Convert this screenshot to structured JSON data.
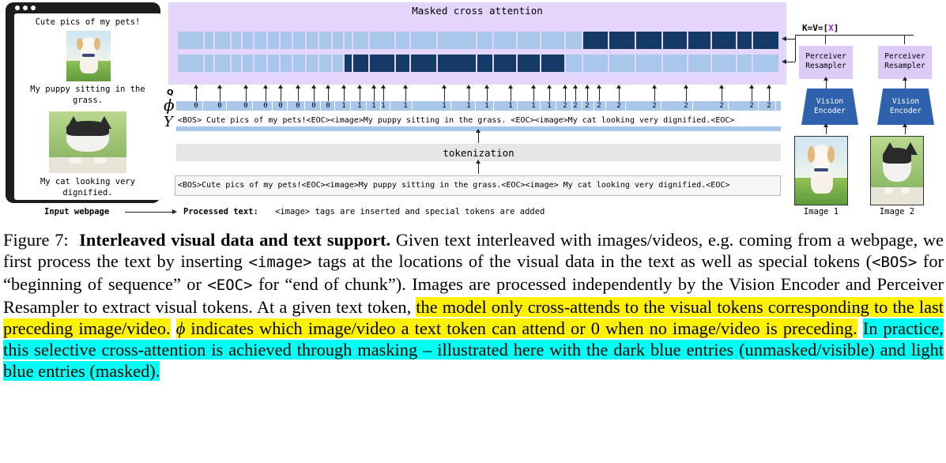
{
  "webpage": {
    "heading": "Cute pics of my pets!",
    "caption_1": "My puppy sitting in the grass.",
    "caption_2": "My cat looking very dignified.",
    "label": "Input webpage"
  },
  "attention": {
    "title": "Masked cross attention",
    "row_1_mask": "light for tokens before second <image>, dark (visible) after it",
    "q_label": "Q"
  },
  "sequence": {
    "phi_symbol": "ϕ",
    "y_symbol": "Y",
    "phi_values": [
      "0",
      "0",
      "0",
      "0",
      "0",
      "0",
      "0",
      "0",
      "1",
      "1",
      "1",
      "1",
      "1",
      "1",
      "1",
      "1",
      "1",
      "1",
      "1",
      "2",
      "2",
      "2",
      "2",
      "2",
      "2",
      "2",
      "2",
      "2",
      "2",
      "2"
    ],
    "y_text": "<BOS> Cute pics of my pets!<EOC><image>My puppy sitting in the grass. <EOC><image>My cat looking very dignified.<EOC>"
  },
  "tokenization": {
    "label": "tokenization",
    "raw_text": "<BOS>Cute pics of my pets!<EOC><image>My puppy sitting in the grass.<EOC><image> My cat looking very dignified.<EOC>"
  },
  "processed": {
    "label": "Processed text:",
    "description": "<image> tags are inserted and special tokens are added"
  },
  "encoders": {
    "kv_label": "K=V=[",
    "kv_x": "X",
    "kv_close": "]",
    "resampler_label": "Perceiver Resampler",
    "encoder_label": "Vision Encoder",
    "image_1": "Image 1",
    "image_2": "Image 2"
  },
  "caption": {
    "fig": "Figure 7:",
    "bold": "Interleaved visual data and text support.",
    "part1": "Given text interleaved with images/videos, e.g. coming from a webpage, we first process the text by inserting",
    "image_tag": "<image>",
    "part2": "tags at the locations of the visual data in the text as well as special tokens (",
    "bos_tag": "<BOS>",
    "part3": "for “beginning of sequence” or",
    "eoc_tag": "<EOC>",
    "part4": "for “end of chunk”). Images are processed independently by the Vision Encoder and Perceiver Resampler to extract visual tokens. At a given text token,",
    "hl1": "the model only cross-attends to the visual tokens corresponding to the last preceding image/video.",
    "phi": "ϕ",
    "hl2": "indicates which image/video a text token can attend or 0 when no image/video is preceding.",
    "hl3": "In practice, this selective cross-attention is achieved through masking – illustrated here with the dark blue entries (unmasked/visible) and light blue entries (masked)."
  },
  "colors": {
    "light_blue": "#a8c7ea",
    "dark_blue": "#143a68",
    "lavender": "#e3d5fb",
    "encoder_blue": "#2f62ad",
    "highlight_yellow": "#fff200",
    "highlight_cyan": "#00fff5"
  }
}
